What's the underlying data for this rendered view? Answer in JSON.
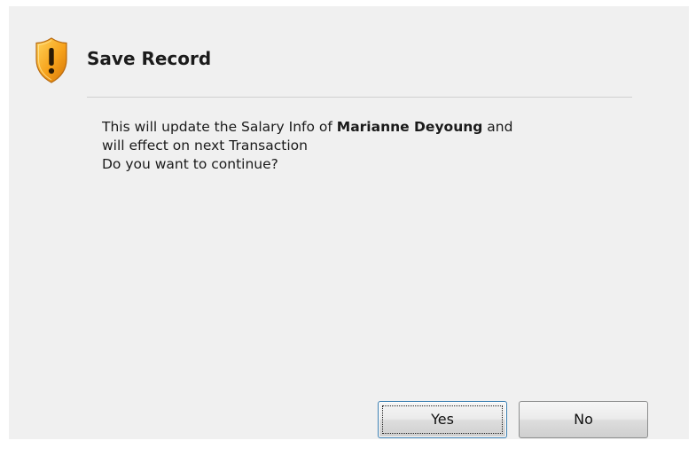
{
  "dialog": {
    "title": "Save Record",
    "icon": "shield-warning-icon",
    "message": {
      "line1_prefix": "This will update the Salary Info of ",
      "line1_name": "Marianne Deyoung",
      "line1_suffix": " and",
      "line2": "will effect on next Transaction",
      "line3": "Do you want to continue?"
    },
    "buttons": {
      "yes_label": "Yes",
      "no_label": "No"
    },
    "colors": {
      "background": "#f0f0f0",
      "shield_orange": "#f29a1f",
      "divider": "#d0d0d0"
    }
  }
}
